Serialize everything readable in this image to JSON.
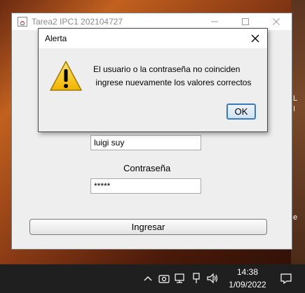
{
  "main_window": {
    "title": "Tarea2 IPC1 202104727",
    "username_value": "luigi suy",
    "password_label": "Contraseña",
    "password_value": "*****",
    "submit_label": "Ingresar"
  },
  "dialog": {
    "title": "Alerta",
    "message_line1": "El usuario o la contraseña no coinciden",
    "message_line2": " ingrese nuevamente los valores correctos",
    "ok_label": "OK",
    "icon": "warning-icon"
  },
  "desktop": {
    "glyph1": "L",
    "glyph2": "I",
    "glyph3": "e"
  },
  "taskbar": {
    "time": "14:38",
    "date": "1/09/2022",
    "icons": [
      "chevron-up-icon",
      "camera-icon",
      "network-icon",
      "volume-icon",
      "notification-icon"
    ]
  },
  "colors": {
    "accent": "#3a7ab8",
    "warning": "#f5c518",
    "taskbar": "#1f1f1f"
  }
}
